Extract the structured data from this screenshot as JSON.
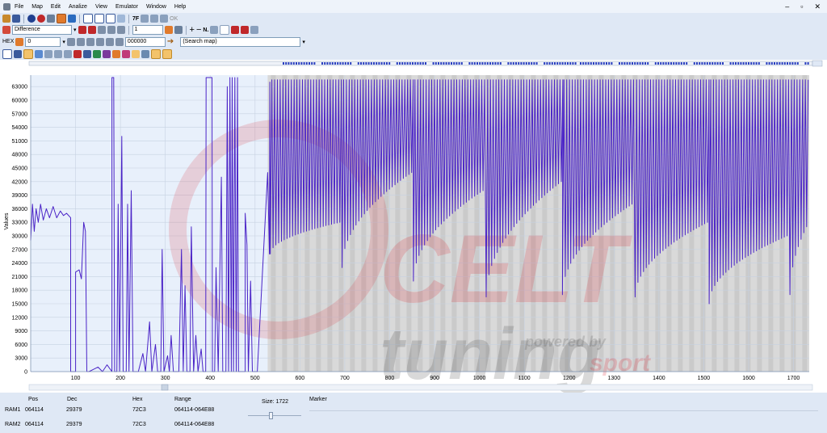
{
  "menu": {
    "items": [
      "File",
      "Map",
      "Edit",
      "Analize",
      "View",
      "Emulator",
      "Window",
      "Help"
    ],
    "window_controls": [
      "–",
      "▫",
      "✕"
    ]
  },
  "toolbar": {
    "mode_select": "Difference",
    "step_value": "1",
    "edit_buttons": [
      "7F",
      "7F",
      "N."
    ],
    "ok_label": "OK",
    "hex_label": "HEX",
    "base_value": "0",
    "address_value": "000000",
    "search_placeholder": "(Search map)"
  },
  "colors": {
    "line": "#4a23c7",
    "plot_bg_left": "#e8f0fb",
    "plot_bg_right": "#d9d9d9",
    "stripe": "#bdbdbd",
    "grid": "#c6d2e2",
    "watermark_red": "#d91c2a",
    "watermark_grey": "#555555"
  },
  "watermark": {
    "line1": "CELT",
    "line2": "tuning",
    "line3": "powered by",
    "line4": "sport"
  },
  "chart_data": {
    "type": "line",
    "ylabel": "Values",
    "xlabel": "",
    "xlim": [
      0,
      1735
    ],
    "ylim": [
      0,
      65535
    ],
    "xticks": [
      100,
      200,
      300,
      400,
      500,
      600,
      700,
      800,
      900,
      1000,
      1100,
      1200,
      1300,
      1400,
      1500,
      1600,
      1700
    ],
    "yticks": [
      0,
      3000,
      6000,
      9000,
      12000,
      15000,
      18000,
      21000,
      24000,
      27000,
      30000,
      33000,
      36000,
      39000,
      42000,
      45000,
      48000,
      51000,
      54000,
      57000,
      60000,
      63000
    ],
    "highlight_start": 528,
    "series": [
      {
        "values": [
          [
            0,
            29000
          ],
          [
            4,
            37000
          ],
          [
            8,
            31000
          ],
          [
            12,
            36000
          ],
          [
            17,
            33000
          ],
          [
            22,
            37000
          ],
          [
            28,
            33500
          ],
          [
            35,
            36000
          ],
          [
            42,
            34000
          ],
          [
            50,
            36500
          ],
          [
            58,
            34000
          ],
          [
            66,
            35500
          ],
          [
            73,
            34500
          ],
          [
            80,
            35000
          ],
          [
            89,
            34000
          ],
          [
            89,
            0
          ],
          [
            100,
            0
          ],
          [
            100,
            22000
          ],
          [
            108,
            22500
          ],
          [
            113,
            20500
          ],
          [
            118,
            33000
          ],
          [
            122,
            31000
          ],
          [
            125,
            0
          ],
          [
            130,
            0
          ],
          [
            140,
            500
          ],
          [
            150,
            1000
          ],
          [
            160,
            0
          ],
          [
            170,
            1500
          ],
          [
            181,
            0
          ],
          [
            181,
            65000
          ],
          [
            185,
            65000
          ],
          [
            187,
            0
          ],
          [
            192,
            0
          ],
          [
            195,
            37000
          ],
          [
            198,
            0
          ],
          [
            203,
            52000
          ],
          [
            206,
            0
          ],
          [
            213,
            0
          ],
          [
            216,
            37000
          ],
          [
            219,
            0
          ],
          [
            224,
            40000
          ],
          [
            228,
            0
          ],
          [
            240,
            0
          ],
          [
            250,
            4000
          ],
          [
            256,
            0
          ],
          [
            265,
            11000
          ],
          [
            270,
            0
          ],
          [
            278,
            6000
          ],
          [
            283,
            0
          ],
          [
            290,
            0
          ],
          [
            293,
            27000
          ],
          [
            297,
            0
          ],
          [
            305,
            3500
          ],
          [
            309,
            0
          ],
          [
            313,
            8000
          ],
          [
            318,
            0
          ],
          [
            330,
            0
          ],
          [
            336,
            27000
          ],
          [
            340,
            0
          ],
          [
            344,
            19000
          ],
          [
            348,
            0
          ],
          [
            355,
            0
          ],
          [
            358,
            32000
          ],
          [
            363,
            0
          ],
          [
            368,
            8000
          ],
          [
            373,
            0
          ],
          [
            380,
            5000
          ],
          [
            384,
            0
          ],
          [
            390,
            0
          ],
          [
            391,
            65000
          ],
          [
            404,
            65000
          ],
          [
            405,
            0
          ],
          [
            410,
            0
          ],
          [
            413,
            23000
          ],
          [
            418,
            0
          ],
          [
            425,
            43000
          ],
          [
            428,
            0
          ],
          [
            435,
            0
          ],
          [
            438,
            63000
          ],
          [
            441,
            0
          ],
          [
            444,
            65000
          ],
          [
            447,
            0
          ],
          [
            449,
            65000
          ],
          [
            452,
            0
          ],
          [
            455,
            65000
          ],
          [
            458,
            0
          ],
          [
            461,
            65000
          ],
          [
            463,
            0
          ],
          [
            470,
            0
          ],
          [
            478,
            0
          ],
          [
            478,
            35000
          ],
          [
            482,
            28000
          ],
          [
            485,
            0
          ],
          [
            490,
            20000
          ],
          [
            494,
            0
          ],
          [
            500,
            0
          ],
          [
            505,
            0
          ],
          [
            528,
            44000
          ],
          [
            532,
            26000
          ],
          [
            533,
            64000
          ]
        ],
        "segments": [
          {
            "start": 534,
            "end": 692,
            "floor_start": 26000,
            "floor_end": 33000,
            "spacing": 6.2
          },
          {
            "start": 694,
            "end": 851,
            "floor_start": 23000,
            "floor_end": 44000,
            "spacing": 6.2
          },
          {
            "start": 853,
            "end": 1013,
            "floor_start": 20000,
            "floor_end": 40000,
            "spacing": 6.2
          },
          {
            "start": 1015,
            "end": 1183,
            "floor_start": 16500,
            "floor_end": 42000,
            "spacing": 6.2
          },
          {
            "start": 1185,
            "end": 1345,
            "floor_start": 17000,
            "floor_end": 37000,
            "spacing": 6.2
          },
          {
            "start": 1347,
            "end": 1510,
            "floor_start": 16500,
            "floor_end": 33000,
            "spacing": 6.2
          },
          {
            "start": 1512,
            "end": 1690,
            "floor_start": 15000,
            "floor_end": 30000,
            "spacing": 6.2
          },
          {
            "start": 1692,
            "end": 1735,
            "floor_start": 17000,
            "floor_end": 32000,
            "spacing": 6.2
          }
        ],
        "peak": 64500
      }
    ]
  },
  "status": {
    "headers": {
      "pos": "Pos",
      "dec": "Dec",
      "hex": "Hex",
      "range": "Range",
      "marker": "Marker"
    },
    "size_label": "Size: 1722",
    "rows": [
      {
        "name": "RAM1",
        "pos": "064114",
        "dec": "29379",
        "hex": "72C3",
        "range": "064114-064E88"
      },
      {
        "name": "RAM2",
        "pos": "064114",
        "dec": "29379",
        "hex": "72C3",
        "range": "064114-064E88"
      }
    ]
  }
}
